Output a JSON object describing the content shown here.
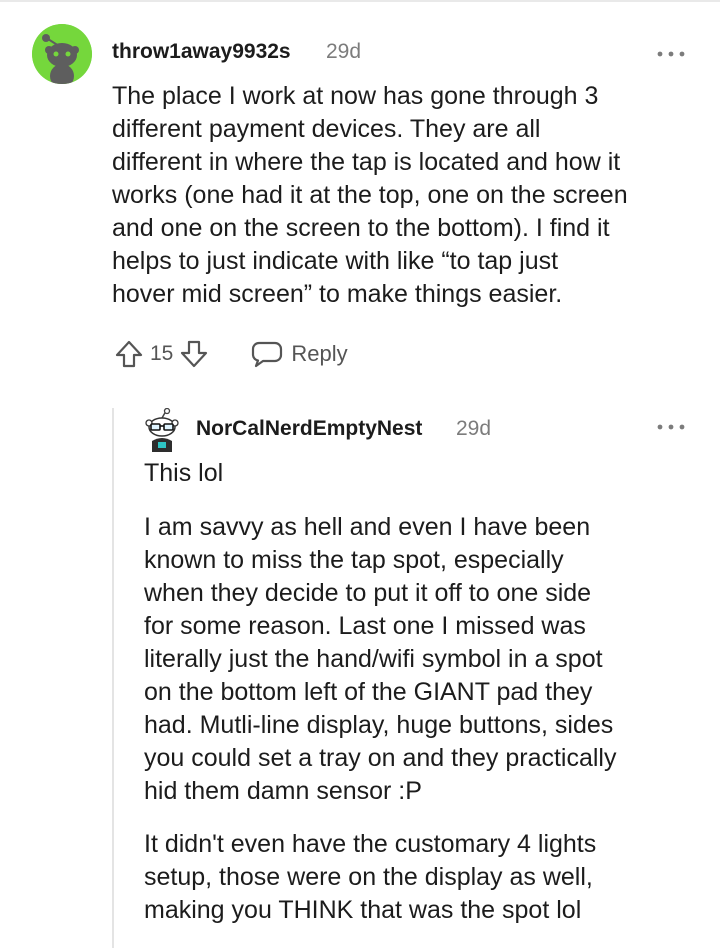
{
  "parent_comment": {
    "username": "throw1away9932s",
    "age": "29d",
    "more_label": "•••",
    "lines": [
      "The place I work at now has gone through 3",
      "different payment devices. They are all",
      "different in where the tap is located and how it",
      "works (one had it at the top, one on the screen",
      "and one on the screen to the bottom). I find it",
      "helps to just indicate with like “to tap just",
      "hover mid screen” to make things easier."
    ],
    "vote_count": "15",
    "reply_label": "Reply",
    "avatar_color": "#75d73c"
  },
  "reply_comment": {
    "username": "NorCalNerdEmptyNest",
    "age": "29d",
    "paragraphs": [
      [
        "This lol"
      ],
      [
        "I am savvy as hell and even I have been",
        "known to miss the tap spot, especially",
        "when they decide to put it off to one side",
        "for some reason. Last one I missed was",
        "literally just the hand/wifi symbol in a spot",
        "on the bottom left of the GIANT pad they",
        "had. Mutli-line display, huge buttons, sides",
        "you could set a tray on and they practically",
        "hid them damn sensor :P"
      ],
      [
        "It didn't even have the customary 4 lights",
        "setup, those were on the display as well,",
        "making you THINK that was the spot lol"
      ]
    ]
  },
  "icons": {
    "avatar_parent": "snoo-avatar-icon",
    "avatar_reply": "snoo-glasses-avatar-icon",
    "upvote": "arrow-up-icon",
    "downvote": "arrow-down-icon",
    "reply": "speech-bubble-icon",
    "more": "more-dots-icon"
  }
}
